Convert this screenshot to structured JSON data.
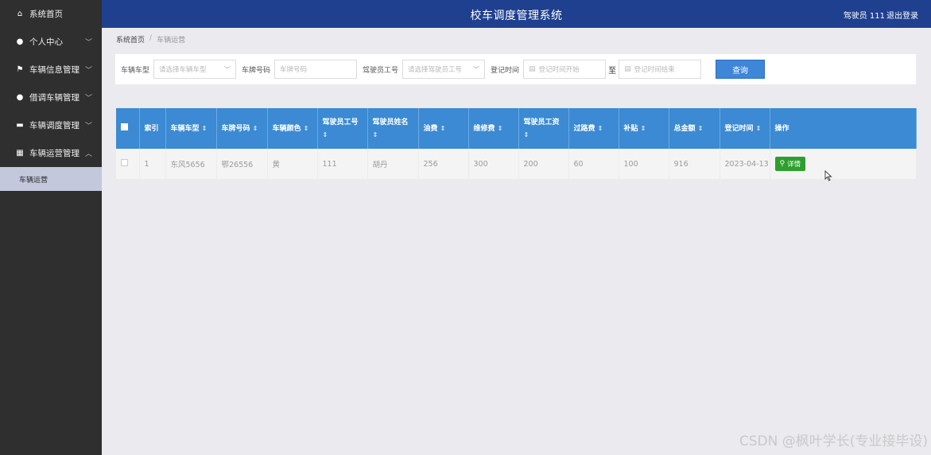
{
  "app": {
    "title": "校车调度管理系统",
    "user": "驾驶员 111",
    "logout": "退出登录"
  },
  "sidebar": {
    "items": [
      {
        "label": "系统首页",
        "icon": "home-icon",
        "glyph": "⌂"
      },
      {
        "label": "个人中心",
        "icon": "user-icon",
        "glyph": "●"
      },
      {
        "label": "车辆信息管理",
        "icon": "flag-icon",
        "glyph": "⚑"
      },
      {
        "label": "借调车辆管理",
        "icon": "user-icon",
        "glyph": "●"
      },
      {
        "label": "车辆调度管理",
        "icon": "briefcase-icon",
        "glyph": "▬"
      },
      {
        "label": "车辆运营管理",
        "icon": "grid-icon",
        "glyph": "▦"
      }
    ],
    "sub_item": "车辆运营"
  },
  "breadcrumb": {
    "home": "系统首页",
    "sep": "/",
    "current": "车辆运营"
  },
  "search": {
    "type_label": "车辆车型",
    "type_placeholder": "请选择车辆车型",
    "plate_label": "车牌号码",
    "plate_placeholder": "车牌号码",
    "driver_label": "驾驶员工号",
    "driver_placeholder": "请选择驾驶员工号",
    "date_label": "登记时间",
    "date_start_placeholder": "登记时间开始",
    "to_label": "至",
    "date_end_placeholder": "登记时间结束",
    "query_button": "查询"
  },
  "table": {
    "headers": [
      "索引",
      "车辆车型",
      "车牌号码",
      "车辆颜色",
      "驾驶员工号",
      "驾驶员姓名",
      "油费",
      "维修费",
      "驾驶员工资",
      "过路费",
      "补贴",
      "总金额",
      "登记时间",
      "操作"
    ],
    "sort_glyph": "⇕",
    "rows": [
      [
        "1",
        "东风5656",
        "鄂26556",
        "黄",
        "111",
        "胡丹",
        "256",
        "300",
        "200",
        "60",
        "100",
        "916",
        "2023-04-13"
      ]
    ],
    "detail_button": "详情"
  },
  "watermark": "CSDN @枫叶学长(专业接毕设)",
  "colors": {
    "header": "#1f3f8f",
    "sidebar": "#2f2f2f",
    "table_head": "#3b8ad3",
    "query_button": "#3d86d8",
    "detail_button": "#2e9e2e"
  }
}
